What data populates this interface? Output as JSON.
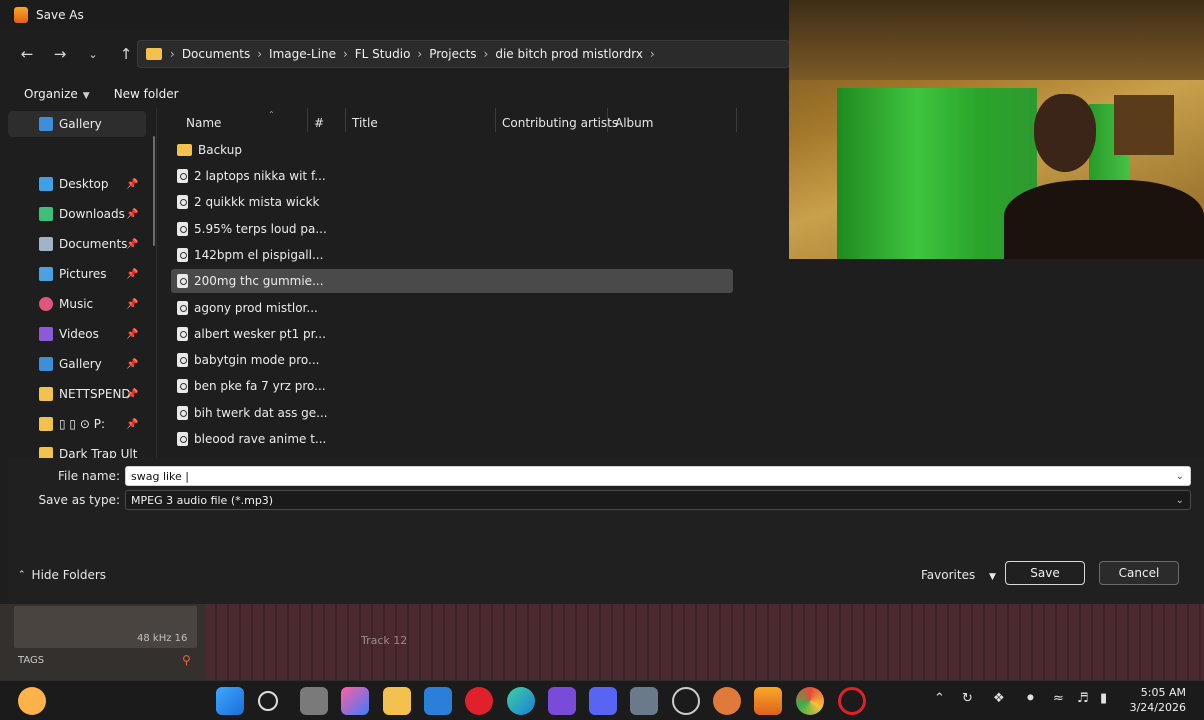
{
  "dialog": {
    "title": "Save As",
    "breadcrumbs": [
      "Documents",
      "Image-Line",
      "FL Studio",
      "Projects",
      "die bitch prod mistlordrx"
    ],
    "toolbar": {
      "organize": "Organize",
      "new_folder": "New folder"
    }
  },
  "sidebar": {
    "items": [
      {
        "label": "Gallery",
        "pinned": false,
        "icon": "gallery-icon",
        "selected": true
      },
      {
        "label": "Desktop",
        "pinned": true,
        "icon": "desktop-icon"
      },
      {
        "label": "Downloads",
        "pinned": true,
        "icon": "downloads-icon"
      },
      {
        "label": "Documents",
        "pinned": true,
        "icon": "documents-icon"
      },
      {
        "label": "Pictures",
        "pinned": true,
        "icon": "pictures-icon"
      },
      {
        "label": "Music",
        "pinned": true,
        "icon": "music-icon"
      },
      {
        "label": "Videos",
        "pinned": true,
        "icon": "videos-icon"
      },
      {
        "label": "Gallery",
        "pinned": true,
        "icon": "gallery-icon"
      },
      {
        "label": "NETTSPEND",
        "pinned": true,
        "icon": "folder-icon"
      },
      {
        "label": "▯   ▯   ⊙ P:",
        "pinned": true,
        "icon": "folder-icon"
      },
      {
        "label": "Dark Trap Ult",
        "pinned": false,
        "icon": "folder-icon"
      }
    ]
  },
  "columns": [
    "Name",
    "#",
    "Title",
    "Contributing artists",
    "Album"
  ],
  "files": [
    {
      "name": "Backup",
      "type": "folder"
    },
    {
      "name": "2 laptops nikka wit f...",
      "type": "file"
    },
    {
      "name": "2 quikkk mista wickk",
      "type": "file"
    },
    {
      "name": "5.95% terps loud pa...",
      "type": "file"
    },
    {
      "name": "142bpm el pispigall...",
      "type": "file"
    },
    {
      "name": "200mg thc gummie...",
      "type": "file",
      "selected": true
    },
    {
      "name": "agony prod mistlor...",
      "type": "file"
    },
    {
      "name": "albert wesker pt1 pr...",
      "type": "file"
    },
    {
      "name": "babytgin mode pro...",
      "type": "file"
    },
    {
      "name": "ben pke fa 7 yrz pro...",
      "type": "file"
    },
    {
      "name": "bih twerk dat ass ge...",
      "type": "file"
    },
    {
      "name": "bleood rave anime t...",
      "type": "file"
    }
  ],
  "form": {
    "file_name_label": "File name:",
    "file_name_value": "swag like |",
    "save_type_label": "Save as type:",
    "save_type_value": "MPEG 3 audio file (*.mp3)",
    "hide_folders": "Hide Folders",
    "favorites": "Favorites",
    "save": "Save",
    "cancel": "Cancel"
  },
  "fl": {
    "sample_rate": "48 kHz 16",
    "tags": "TAGS",
    "track": "Track 12"
  },
  "taskbar": {
    "time": "5:05 AM",
    "date": "3/24/2026"
  },
  "colors": {
    "selected_row": "#4a4a4a",
    "folder": "#f2c14e",
    "accent_green": "#3fc53f"
  }
}
